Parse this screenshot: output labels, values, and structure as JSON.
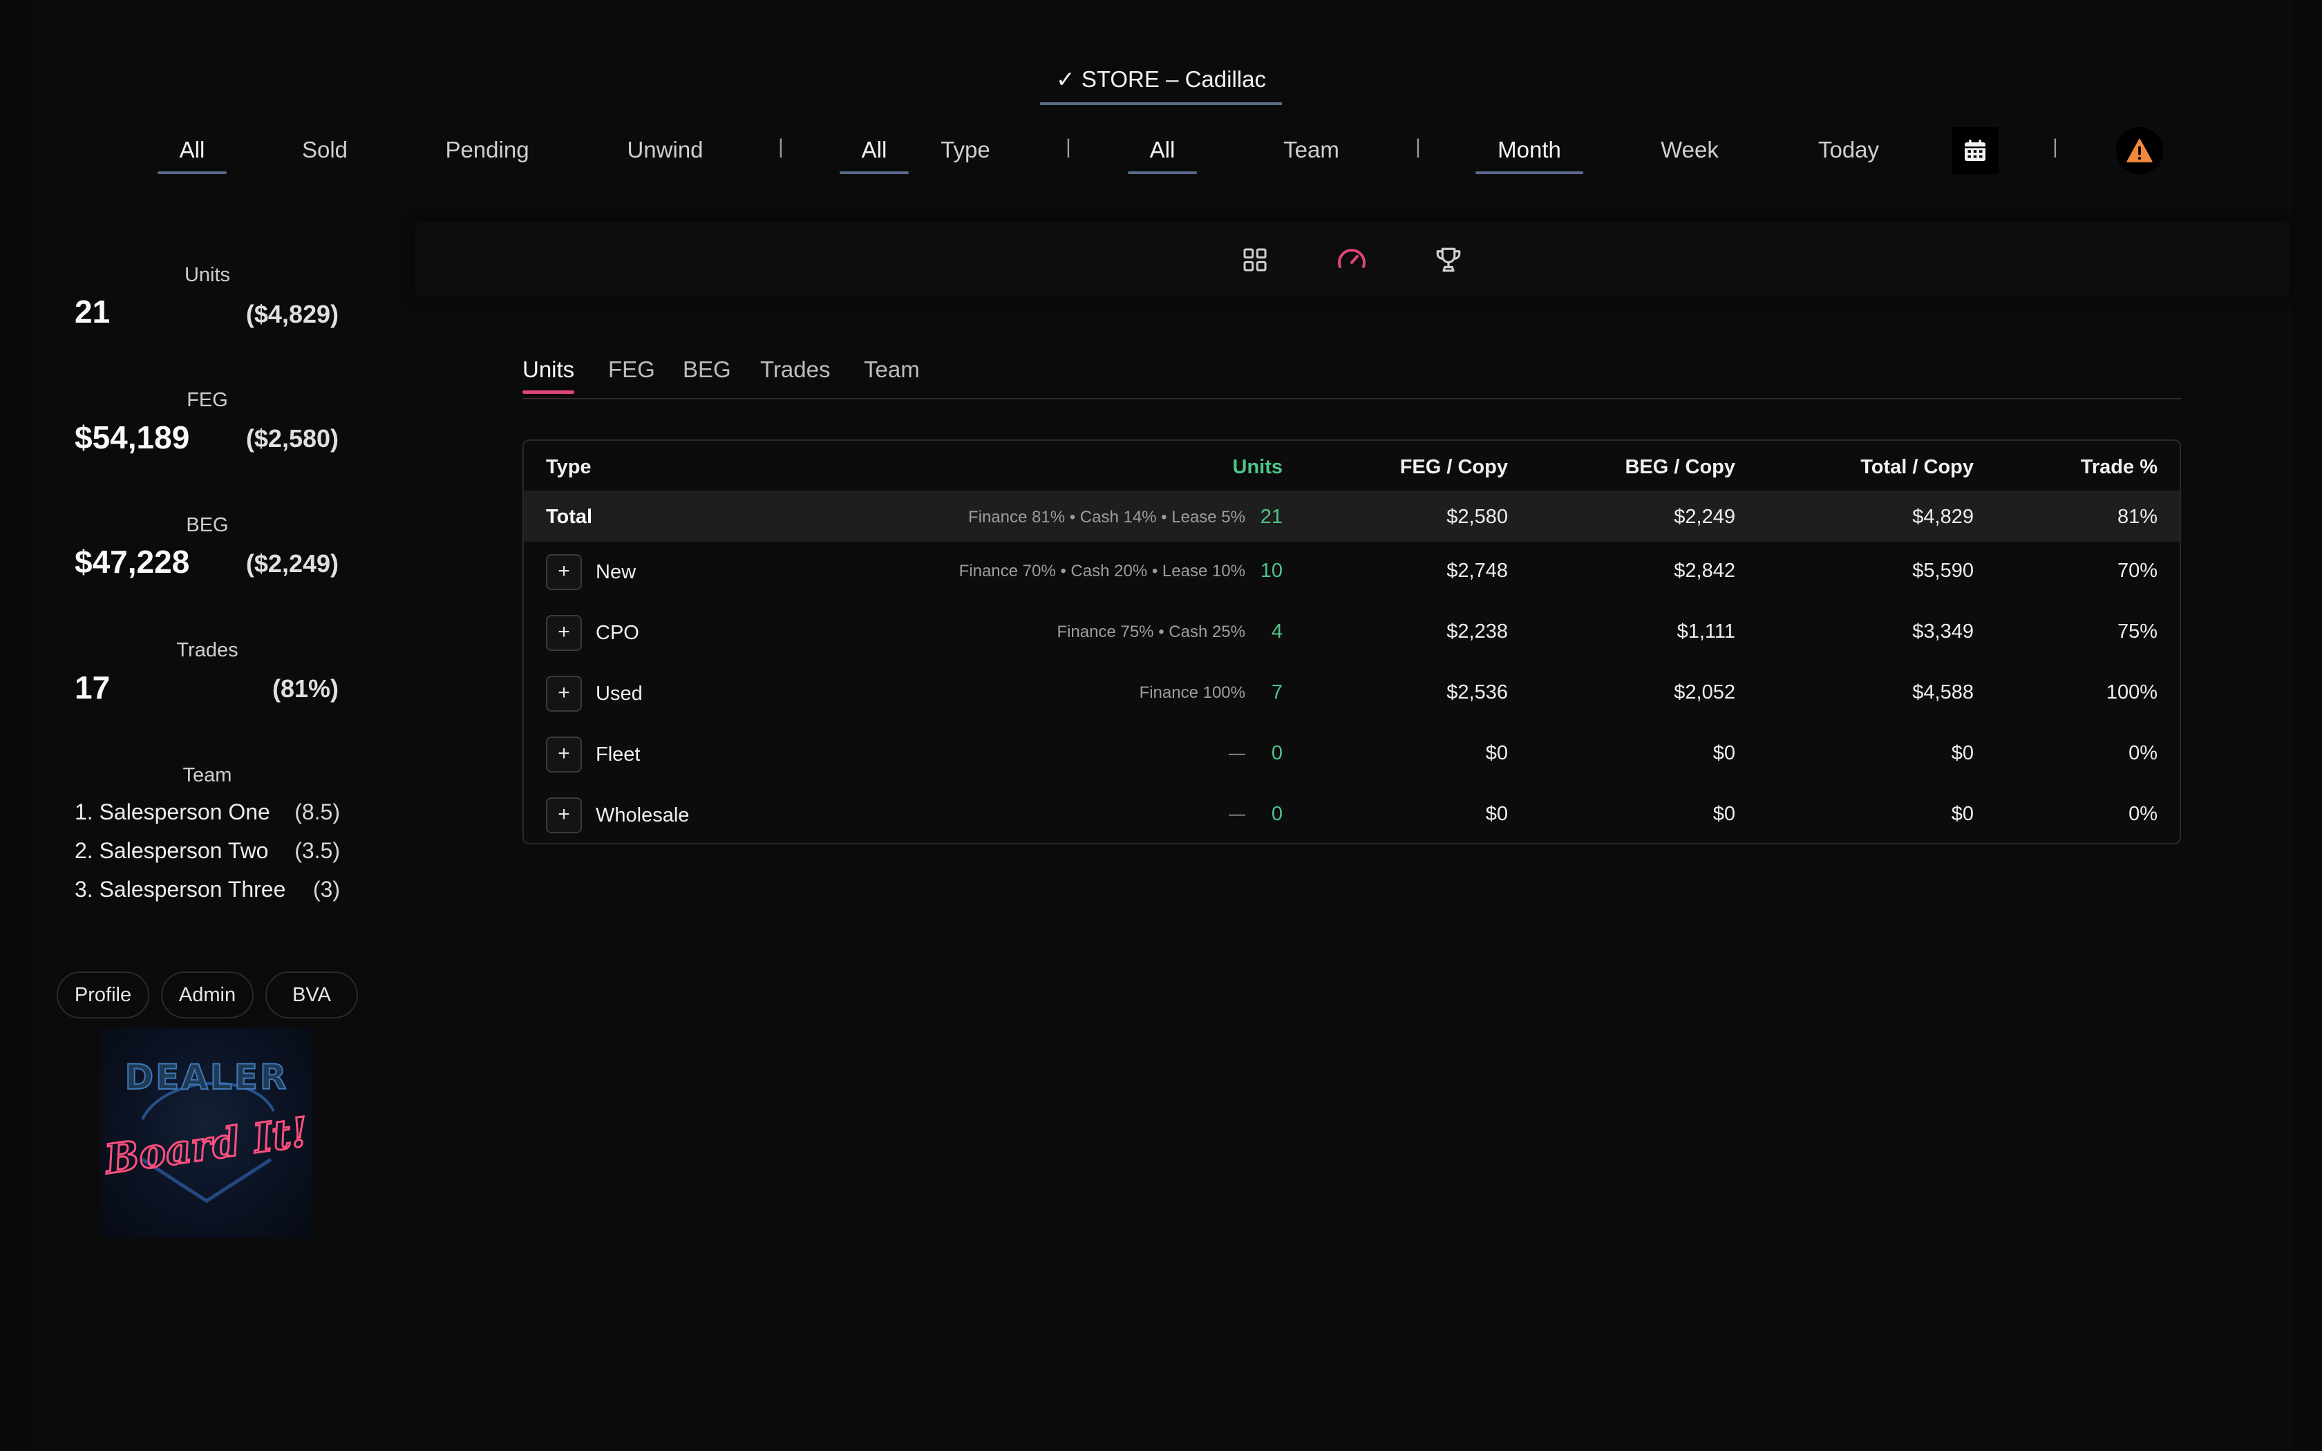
{
  "store": {
    "label": "✓ STORE – Cadillac"
  },
  "filters": {
    "status": [
      "All",
      "Sold",
      "Pending",
      "Unwind"
    ],
    "separator": "|",
    "type": [
      "All",
      "Type"
    ],
    "team": [
      "All",
      "Team"
    ],
    "period": [
      "Month",
      "Week",
      "Today"
    ]
  },
  "sidebar": {
    "units": {
      "caption": "Units",
      "value": "21",
      "side": "($4,829)"
    },
    "feg": {
      "caption": "FEG",
      "value": "$54,189",
      "side": "($2,580)"
    },
    "beg": {
      "caption": "BEG",
      "value": "$47,228",
      "side": "($2,249)"
    },
    "trades": {
      "caption": "Trades",
      "value": "17",
      "side": "(81%)"
    },
    "team": {
      "caption": "Team",
      "members": [
        {
          "name": "1. Salesperson One",
          "value": "(8.5)"
        },
        {
          "name": "2. Salesperson Two",
          "value": "(3.5)"
        },
        {
          "name": "3. Salesperson Three",
          "value": "(3)"
        }
      ]
    },
    "buttons": [
      "Profile",
      "Admin",
      "BVA"
    ],
    "logo": {
      "line1": "DEALER",
      "line2": "Board It!"
    }
  },
  "tabs": [
    "Units",
    "FEG",
    "BEG",
    "Trades",
    "Team"
  ],
  "table": {
    "headers": [
      "Type",
      "Units",
      "FEG / Copy",
      "BEG / Copy",
      "Total / Copy",
      "Trade %"
    ],
    "total": {
      "label": "Total",
      "mix": "Finance 81% • Cash 14% • Lease 5%",
      "units": "21",
      "feg": "$2,580",
      "beg": "$2,249",
      "total": "$4,829",
      "trade": "81%"
    },
    "rows": [
      {
        "label": "New",
        "mix": "Finance 70% • Cash 20% • Lease 10%",
        "units": "10",
        "feg": "$2,748",
        "beg": "$2,842",
        "total": "$5,590",
        "trade": "70%"
      },
      {
        "label": "CPO",
        "mix": "Finance 75% • Cash 25%",
        "units": "4",
        "feg": "$2,238",
        "beg": "$1,111",
        "total": "$3,349",
        "trade": "75%"
      },
      {
        "label": "Used",
        "mix": "Finance 100%",
        "units": "7",
        "feg": "$2,536",
        "beg": "$2,052",
        "total": "$4,588",
        "trade": "100%"
      },
      {
        "label": "Fleet",
        "mix": "—",
        "units": "0",
        "feg": "$0",
        "beg": "$0",
        "total": "$0",
        "trade": "0%"
      },
      {
        "label": "Wholesale",
        "mix": "—",
        "units": "0",
        "feg": "$0",
        "beg": "$0",
        "total": "$0",
        "trade": "0%"
      }
    ],
    "expand_symbol": "+"
  },
  "colors": {
    "accent_pink": "#e0457b",
    "units_green": "#4fc48a",
    "underline_blue": "#5b6a8c",
    "alert_orange": "#f0883e"
  },
  "icons": {
    "grid": "grid-icon",
    "speed": "speedometer-icon",
    "trophy": "trophy-icon",
    "calendar": "calendar-icon",
    "alert": "warning-icon"
  }
}
